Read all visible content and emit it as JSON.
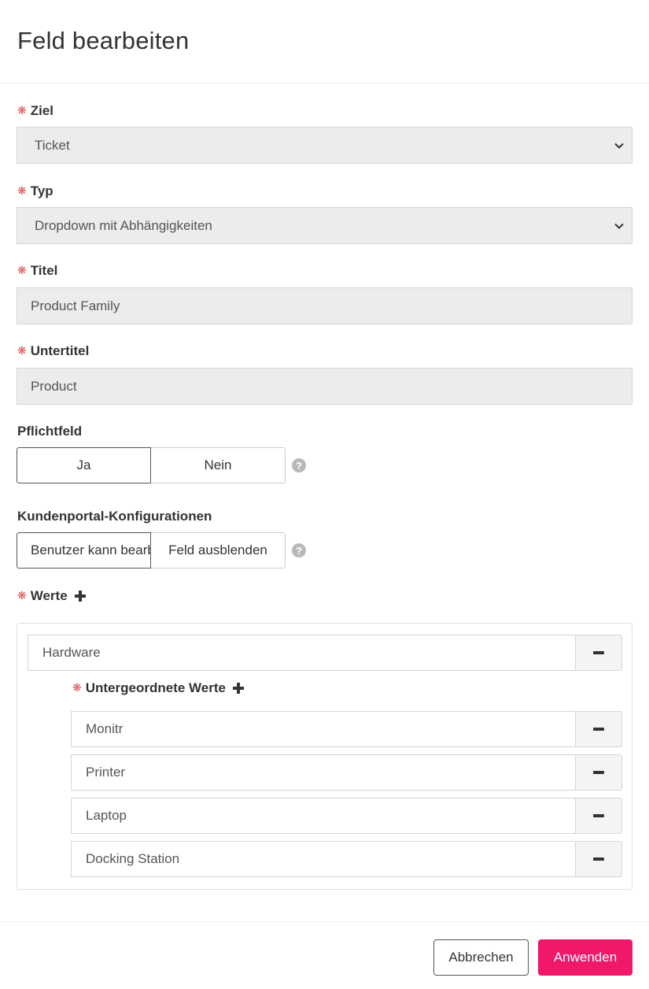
{
  "dialog": {
    "title": "Feld bearbeiten"
  },
  "form": {
    "required_marker": "❋",
    "target": {
      "label": "Ziel",
      "value": "Ticket"
    },
    "type": {
      "label": "Typ",
      "value": "Dropdown mit Abhängigkeiten"
    },
    "title_field": {
      "label": "Titel",
      "value": "Product Family"
    },
    "subtitle_field": {
      "label": "Untertitel",
      "value": "Product"
    },
    "mandatory": {
      "label": "Pflichtfeld",
      "options": [
        "Ja",
        "Nein"
      ],
      "help": "?"
    },
    "portal_config": {
      "label": "Kundenportal-Konfigurationen",
      "options": [
        "Benutzer kann bearbeiten",
        "Feld ausblenden"
      ],
      "help": "?"
    },
    "values": {
      "label": "Werte",
      "items": [
        {
          "value": "Hardware",
          "children_label": "Untergeordnete Werte",
          "children": [
            "Monitr",
            "Printer",
            "Laptop",
            "Docking Station"
          ]
        }
      ]
    }
  },
  "footer": {
    "cancel_label": "Abbrechen",
    "apply_label": "Anwenden"
  },
  "colors": {
    "accent": "#f0186a",
    "required": "#d9534f",
    "field_bg": "#ececec"
  }
}
